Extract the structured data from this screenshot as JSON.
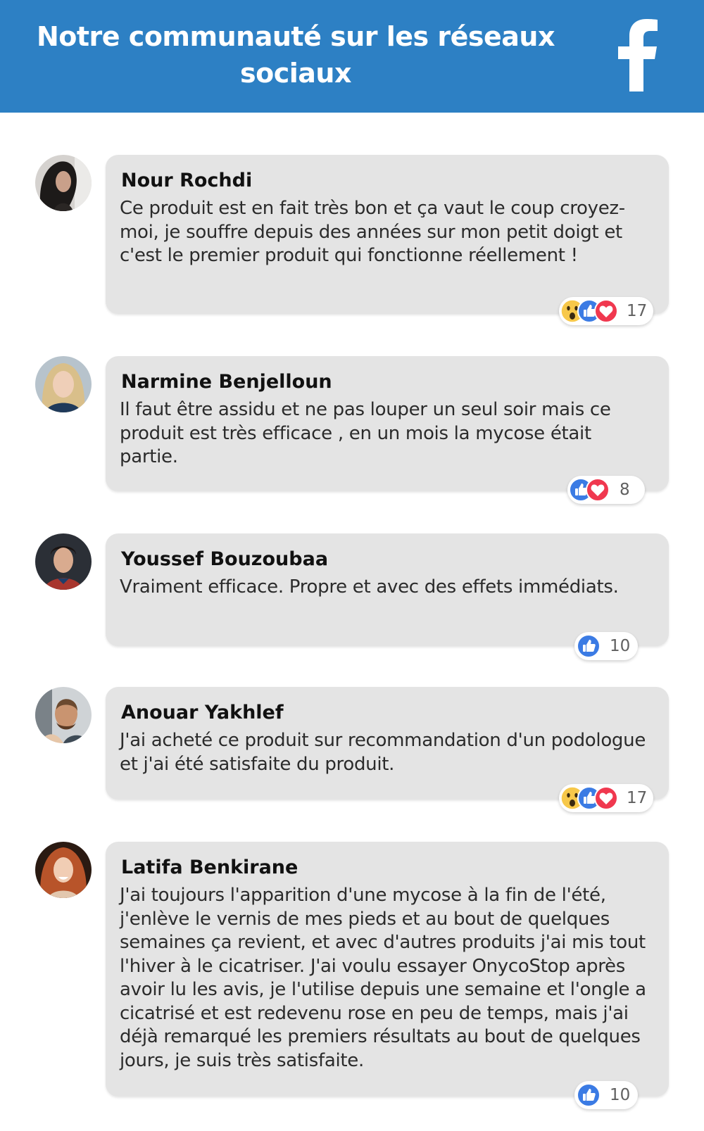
{
  "header": {
    "title": "Notre communauté sur les réseaux sociaux",
    "logo_icon": "facebook-f-icon",
    "background_color": "#2d80c4"
  },
  "comments": [
    {
      "author": "Nour Rochdi",
      "text": "Ce produit est en fait très bon et ça vaut le coup croyez-moi, je souffre depuis des années sur mon petit doigt et c'est le premier produit qui fonctionne réellement !",
      "reactions": [
        "wow",
        "like",
        "love"
      ],
      "count": "17"
    },
    {
      "author": "Narmine Benjelloun",
      "text": "Il faut être assidu et ne pas louper un seul soir mais ce produit est très efficace , en un mois la mycose était partie.",
      "reactions": [
        "like",
        "love"
      ],
      "count": "8"
    },
    {
      "author": "Youssef Bouzoubaa",
      "text": "Vraiment efficace. Propre et avec des effets immédiats.",
      "reactions": [
        "like"
      ],
      "count": "10"
    },
    {
      "author": "Anouar Yakhlef",
      "text": "J'ai acheté ce produit sur recommandation d'un podologue et j'ai été satisfaite du produit.",
      "reactions": [
        "wow",
        "like",
        "love"
      ],
      "count": "17"
    },
    {
      "author": "Latifa Benkirane",
      "text": "J'ai toujours l'apparition d'une mycose à la fin de l'été, j'enlève le vernis de mes pieds et au bout de quelques semaines ça revient, et avec d'autres produits j'ai mis tout l'hiver à le cicatriser. J'ai voulu essayer OnycoStop après avoir lu les avis, je l'utilise depuis une semaine et l'ongle a cicatrisé et est redevenu rose en peu de temps, mais j'ai déjà remarqué les premiers résultats au bout de quelques jours, je suis très satisfaite.",
      "reactions": [
        "like"
      ],
      "count": "10"
    }
  ],
  "colors": {
    "like": "#3b7be4",
    "love": "#f0384f",
    "wow": "#f7c84a",
    "bubble": "#e4e4e4"
  }
}
